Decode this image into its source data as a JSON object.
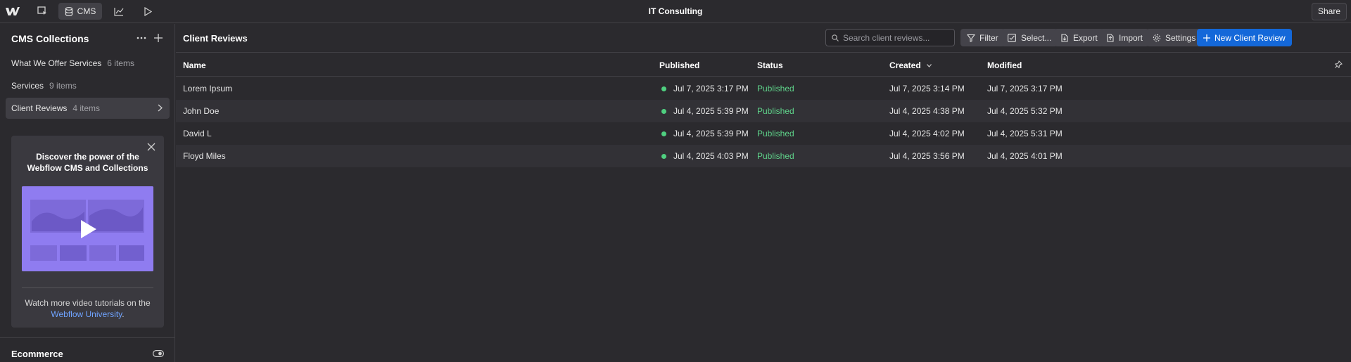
{
  "topbar": {
    "title": "IT Consulting",
    "cms_label": "CMS",
    "share_label": "Share",
    "icons": [
      "webflow-logo-icon",
      "cursor-box-icon",
      "database-icon",
      "analytics-icon",
      "play-icon"
    ]
  },
  "sidebar": {
    "header": "CMS Collections",
    "collections": [
      {
        "name": "What We Offer Services",
        "count": "6 items"
      },
      {
        "name": "Services",
        "count": "9 items"
      },
      {
        "name": "Client Reviews",
        "count": "4 items"
      }
    ],
    "promo": {
      "title": "Discover the power of the Webflow CMS and Collections",
      "text": "Watch more video tutorials on the",
      "link": "Webflow University",
      "suffix": "."
    },
    "ecommerce_label": "Ecommerce"
  },
  "main": {
    "title": "Client Reviews",
    "search_placeholder": "Search client reviews...",
    "buttons": {
      "filter": "Filter",
      "select": "Select...",
      "export": "Export",
      "import": "Import",
      "settings": "Settings",
      "new_item": "New Client Review"
    },
    "columns": {
      "name": "Name",
      "published": "Published",
      "status": "Status",
      "created": "Created",
      "modified": "Modified"
    },
    "rows": [
      {
        "name": "Lorem Ipsum",
        "published": "Jul 7, 2025 3:17 PM",
        "status": "Published",
        "created": "Jul 7, 2025 3:14 PM",
        "modified": "Jul 7, 2025 3:17 PM"
      },
      {
        "name": "John Doe",
        "published": "Jul 4, 2025 5:39 PM",
        "status": "Published",
        "created": "Jul 4, 2025 4:38 PM",
        "modified": "Jul 4, 2025 5:32 PM"
      },
      {
        "name": "David L",
        "published": "Jul 4, 2025 5:39 PM",
        "status": "Published",
        "created": "Jul 4, 2025 4:02 PM",
        "modified": "Jul 4, 2025 5:31 PM"
      },
      {
        "name": "Floyd Miles",
        "published": "Jul 4, 2025 4:03 PM",
        "status": "Published",
        "created": "Jul 4, 2025 3:56 PM",
        "modified": "Jul 4, 2025 4:01 PM"
      }
    ]
  },
  "colors": {
    "background": "#2b2a2e",
    "accent": "#1468d9",
    "published_green": "#5fd38a",
    "link": "#6fa3ff",
    "video": "#8f7cf0"
  }
}
